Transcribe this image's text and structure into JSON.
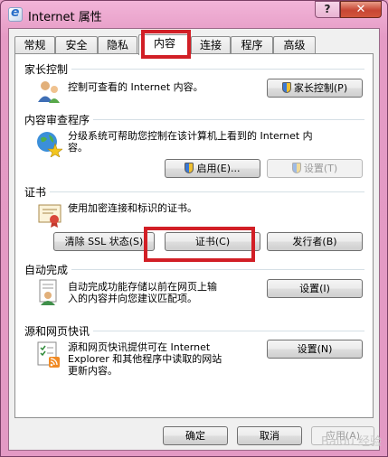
{
  "window": {
    "title": "Internet 属性",
    "help": "?",
    "close": "✕"
  },
  "tabs": [
    {
      "label": "常规"
    },
    {
      "label": "安全"
    },
    {
      "label": "隐私"
    },
    {
      "label": "内容"
    },
    {
      "label": "连接"
    },
    {
      "label": "程序"
    },
    {
      "label": "高级"
    }
  ],
  "active_tab": "内容",
  "parental": {
    "title": "家长控制",
    "desc": "控制可查看的 Internet 内容。",
    "button": "家长控制(P)"
  },
  "advisor": {
    "title": "内容审查程序",
    "desc_line1": "分级系统可帮助您控制在该计算机上看到的 Internet 内",
    "desc_line2": "容。",
    "enable": "启用(E)...",
    "settings": "设置(T)"
  },
  "certs": {
    "title": "证书",
    "desc": "使用加密连接和标识的证书。",
    "clear_ssl": "清除 SSL 状态(S)",
    "certificates": "证书(C)",
    "publishers": "发行者(B)"
  },
  "autocomplete": {
    "title": "自动完成",
    "desc_line1": "自动完成功能存储以前在网页上输",
    "desc_line2": "入的内容并向您建议匹配项。",
    "settings": "设置(I)"
  },
  "feeds": {
    "title": "源和网页快讯",
    "desc_line1": "源和网页快讯提供可在 Internet",
    "desc_line2": "Explorer 和其他程序中读取的网站",
    "desc_line3": "更新内容。",
    "settings": "设置(N)"
  },
  "footer": {
    "ok": "确定",
    "cancel": "取消",
    "apply": "应用(A)"
  },
  "watermark": "Baidu 经验",
  "colors": {
    "highlight_box": "#d21f26",
    "title_bar": "#e59bc5"
  }
}
